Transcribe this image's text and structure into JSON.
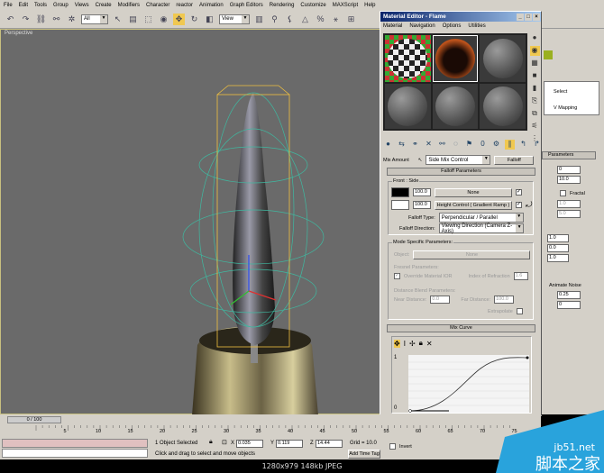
{
  "menu": [
    "File",
    "Edit",
    "Tools",
    "Group",
    "Views",
    "Create",
    "Modifiers",
    "Character",
    "reactor",
    "Animation",
    "Graph Editors",
    "Rendering",
    "Customize",
    "MAXScript",
    "Help"
  ],
  "toolbar": {
    "selection_filter": "All",
    "ref_coord": "View"
  },
  "viewport": {
    "label": "Perspective"
  },
  "material_editor": {
    "title": "Material Editor - Flame",
    "menu": [
      "Material",
      "Navigation",
      "Options",
      "Utilities"
    ],
    "mix_amount_label": "Mix Amount",
    "map_name": "Side Mix Control",
    "map_type": "Falloff",
    "falloff_rollout": "Falloff Parameters",
    "front_side_label": "Front : Side",
    "front_amount": "100.0",
    "side_amount": "100.0",
    "front_map": "None",
    "side_map": "Height Control  ( Gradient Ramp )",
    "falloff_type_label": "Falloff Type:",
    "falloff_type": "Perpendicular / Parallel",
    "falloff_direction_label": "Falloff Direction:",
    "falloff_direction": "Viewing Direction (Camera Z-Axis)",
    "mode_group": "Mode Specific Parameters:",
    "object_label": "Object:",
    "object_value": "None",
    "fresnel_label": "Fresnel Parameters:",
    "override_ior": "Override Material IOR",
    "ior_label": "Index of Refraction",
    "ior_value": "1.6",
    "distance_label": "Distance Blend Parameters:",
    "near_label": "Near Distance:",
    "near_value": "0.0",
    "far_label": "Far Distance:",
    "far_value": "100.0",
    "extrapolate": "Extrapolate",
    "mix_curve_rollout": "Mix Curve",
    "curve_y_max": "1",
    "curve_y_min": "0"
  },
  "command_panel": {
    "modifier_items": [
      "Select",
      "V Mapping"
    ],
    "params_rollout": "Parameters",
    "fields": [
      "0",
      "10.0",
      "1.0",
      "5.0",
      "1.0",
      "0.0",
      "1.0"
    ],
    "fractal": "Fractal",
    "animate_noise": "Animate Noise",
    "freq": "0.25",
    "phase": "0",
    "invert": "Invert"
  },
  "timeline": {
    "frame": "0 / 100",
    "ticks": [
      "5",
      "10",
      "15",
      "20",
      "25",
      "30",
      "35",
      "40",
      "45",
      "50",
      "55",
      "60",
      "65",
      "70",
      "75"
    ]
  },
  "status": {
    "selected": "1 Object Selected",
    "x": "0.035",
    "y": "0.119",
    "z": "14.44",
    "grid": "Grid = 10.0",
    "prompt": "Click and drag to select and move objects",
    "add_time_tag": "Add Time Tag"
  },
  "caption": "1280x979  148kb  JPEG",
  "watermark": {
    "site": "jb51.net",
    "name": "脚本之家"
  }
}
